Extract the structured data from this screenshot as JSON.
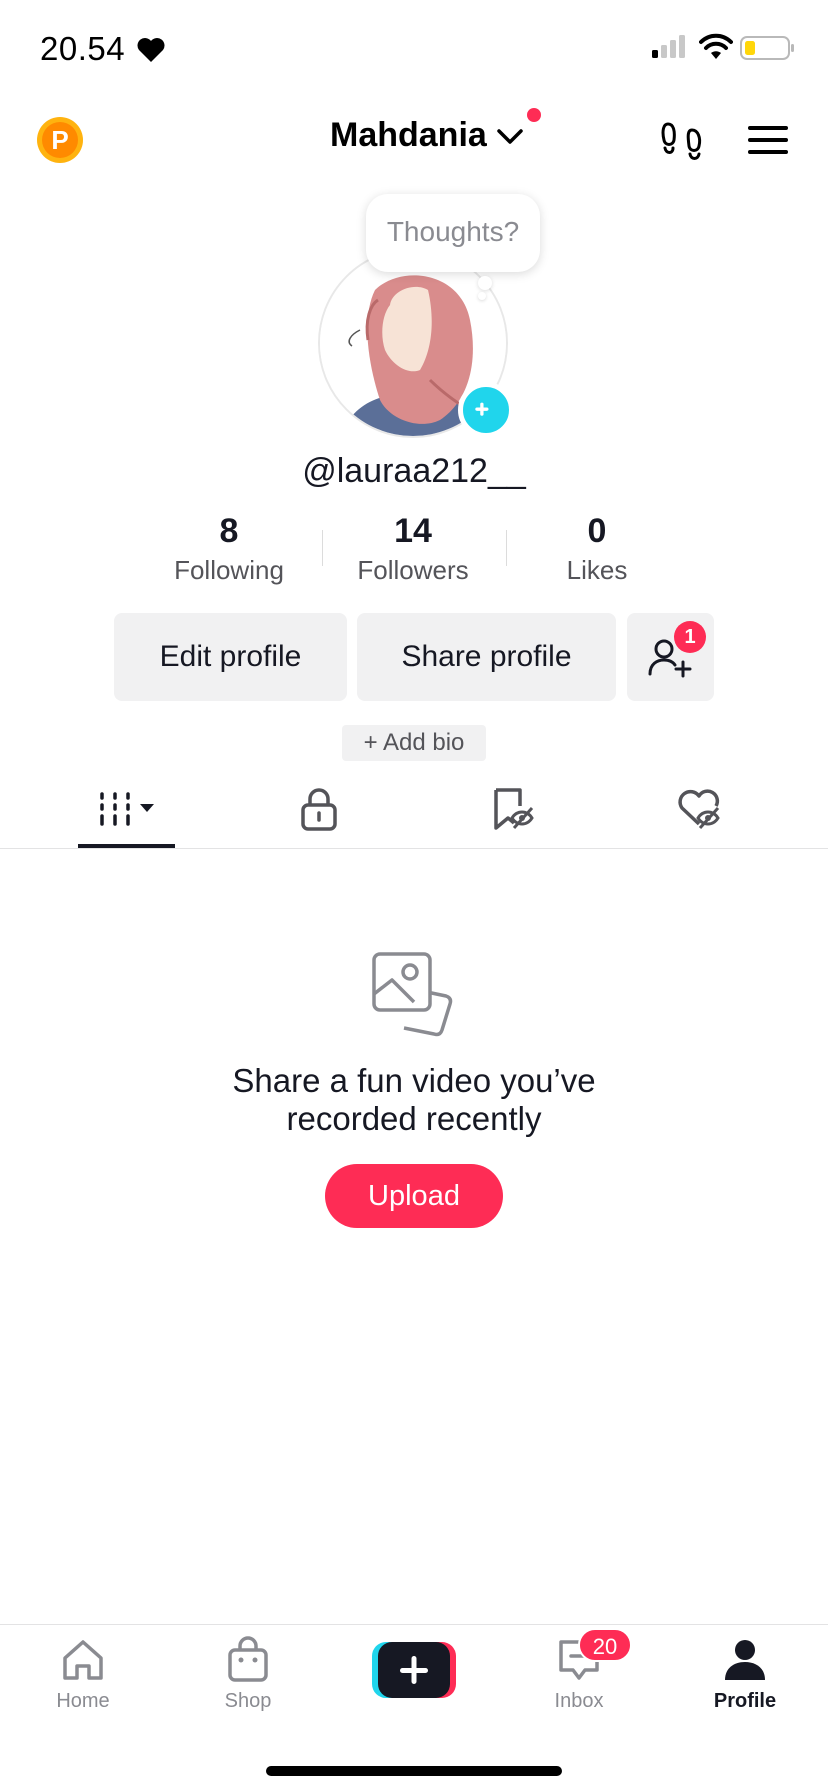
{
  "status_bar": {
    "time": "20.54",
    "battery_level": 0.2,
    "accent_color": "#fe2c55"
  },
  "header": {
    "account_name": "Mahdania",
    "coin_letter": "P"
  },
  "profile": {
    "bubble_text": "Thoughts?",
    "username": "@lauraa212__",
    "stats": [
      {
        "value": "8",
        "label": "Following"
      },
      {
        "value": "14",
        "label": "Followers"
      },
      {
        "value": "0",
        "label": "Likes"
      }
    ],
    "buttons": {
      "edit": "Edit profile",
      "share": "Share profile",
      "add_friend_badge": "1"
    },
    "add_bio": "+ Add bio"
  },
  "tabs": {
    "icons": [
      "videos-grid-icon",
      "lock-icon",
      "repost-hidden-icon",
      "liked-hidden-icon"
    ],
    "selected": 0
  },
  "empty_state": {
    "message": "Share a fun video you’ve recorded recently",
    "button": "Upload"
  },
  "bottom_nav": {
    "items": [
      {
        "label": "Home",
        "icon": "home-icon"
      },
      {
        "label": "Shop",
        "icon": "shop-bag-icon"
      },
      {
        "label": "",
        "icon": "create-plus-icon"
      },
      {
        "label": "Inbox",
        "icon": "inbox-icon",
        "badge": "20"
      },
      {
        "label": "Profile",
        "icon": "profile-icon"
      }
    ],
    "active": 4
  },
  "colors": {
    "brand_red": "#fe2c55",
    "brand_cyan": "#20d5ec",
    "button_gray": "#f1f1f2",
    "coin_orange": "#ffb30f"
  }
}
